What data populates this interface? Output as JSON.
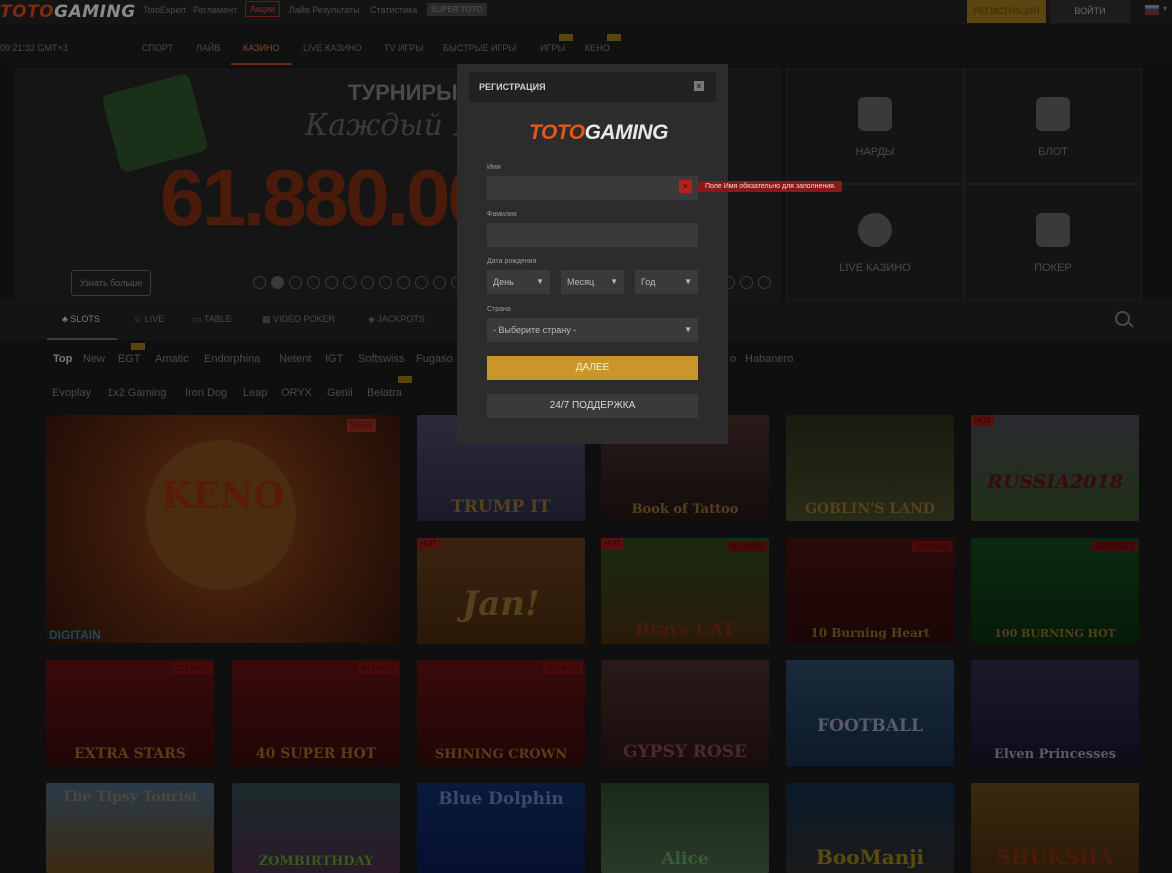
{
  "header": {
    "logo_toto": "TOTO",
    "logo_gaming": "GAMING",
    "links": [
      "TotoExpert",
      "Регламент",
      "Акции",
      "Лайв Результаты",
      "Статистика"
    ],
    "supertoto": "SUPER TOTO",
    "register": "РЕГИСТРАЦИЯ",
    "login": "ВОЙТИ"
  },
  "clock": "09:21:32 GMT+3",
  "nav": [
    "СПОРТ",
    "ЛАЙВ",
    "КАЗИНО",
    "LIVE КАЗИНО",
    "TV ИГРЫ",
    "БЫСТРЫЕ ИГРЫ",
    "ИГРЫ",
    "КЕНО"
  ],
  "banner": {
    "title": "ТУРНИРЫ",
    "subtitle": "Каждый мес",
    "amount": "61.880.00",
    "learn_more": "Узнать больше"
  },
  "tiles": [
    "НАРДЫ",
    "БЛОТ",
    "LIVE КАЗИНО",
    "ПОКЕР"
  ],
  "categories": [
    "SLOTS",
    "LIVE",
    "TABLE",
    "VIDEO POKER",
    "JACKPOTS"
  ],
  "providers_row1": [
    "Top",
    "New",
    "EGT",
    "Amatic",
    "Endorphina",
    "Netent",
    "IGT",
    "Softswiss",
    "Fugaso"
  ],
  "providers_row1_tail": "Habanero",
  "providers_row1_partial": "o",
  "providers_row2": [
    "Evoplay",
    "1x2 Gaming",
    "Iron Dog",
    "Leap",
    "ORYX",
    "Genii",
    "Belatra"
  ],
  "games": {
    "keno": "KENO",
    "keno_brand": "DIGITAIN",
    "trump": "TRUMP IT",
    "tattoo": "Book of Tattoo",
    "goblin": "GOBLIN'S LAND",
    "russia": "RUSSIA2018",
    "jan": "Jan!",
    "brave": "Brave CAT",
    "hot10": "10 Burning Heart",
    "shot100": "100 BURNING HOT",
    "stars": "EXTRA STARS",
    "superhot": "40 SUPER HOT",
    "crown": "SHINING CROWN",
    "gypsy": "GYPSY ROSE",
    "football": "FOOTBALL",
    "elven": "Elven Princesses",
    "tipsy": "The Tipsy Tourist",
    "zombi": "ZOMBIRTHDAY",
    "dolphin": "Blue Dolphin",
    "alice": "Alice",
    "boomanji": "BooManji",
    "shuksha": "SHUKSHA"
  },
  "tags": {
    "new": "NEW",
    "hot": "HOT",
    "l10": "10 LINES",
    "l40": "40 LINES",
    "l100": "100 LINES"
  },
  "modal": {
    "title": "РЕГИСТРАЦИЯ",
    "close": "×",
    "logo_toto": "TOTO",
    "logo_gaming": "GAMING",
    "name_label": "Имя",
    "error_icon": "×",
    "error_msg": "Поле Имя обязательно для заполнения.",
    "surname_label": "Фамилия",
    "dob_label": "Дата рождения",
    "day": "День",
    "month": "Месяц",
    "year": "Год",
    "country_label": "Страна",
    "country_placeholder": "- Выберите страну -",
    "next": "ДАЛЕЕ",
    "support": "24/7 ПОДДЕРЖКА"
  },
  "colors": {
    "accent": "#c8962a",
    "brand": "#e2571a",
    "error": "#b22020"
  }
}
